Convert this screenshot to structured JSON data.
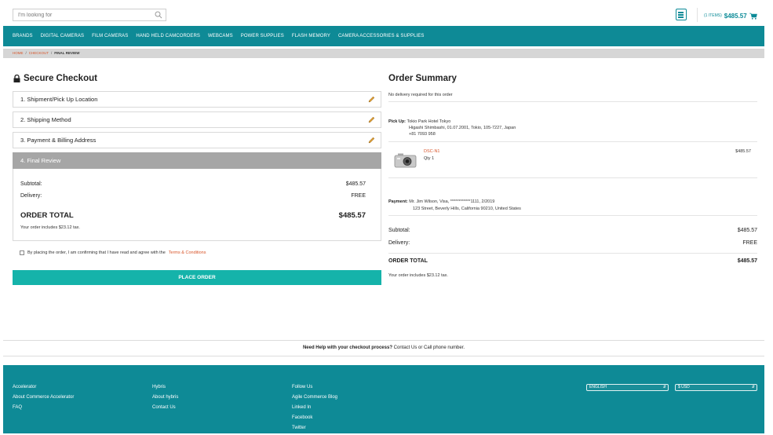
{
  "header": {
    "search_placeholder": "I'm looking for",
    "cart_items": "(1 ITEMS)",
    "cart_total": "$485.57"
  },
  "nav": {
    "items": [
      "BRANDS",
      "DIGITAL CAMERAS",
      "FILM CAMERAS",
      "HAND HELD CAMCORDERS",
      "WEBCAMS",
      "POWER SUPPLIES",
      "FLASH MEMORY",
      "CAMERA ACCESSORIES & SUPPLIES"
    ]
  },
  "breadcrumb": {
    "home": "HOME",
    "checkout": "CHECKOUT",
    "current": "FINAL REVIEW",
    "separator": "/"
  },
  "checkout": {
    "title": "Secure Checkout",
    "steps": [
      "1. Shipment/Pick Up Location",
      "2. Shipping Method",
      "3. Payment & Billing Address",
      "4. Final Review"
    ],
    "subtotal_label": "Subtotal:",
    "subtotal_value": "$485.57",
    "delivery_label": "Delivery:",
    "delivery_value": "FREE",
    "order_total_label": "ORDER TOTAL",
    "order_total_value": "$485.57",
    "tax_note": "Your order includes $23.12 tax.",
    "agree_text": "By placing the order, I am confirming that I have read and agree with the",
    "terms_link": "Terms & Conditions",
    "place_order": "PLACE ORDER"
  },
  "summary": {
    "title": "Order Summary",
    "no_delivery": "No delivery required for this order",
    "pickup_label": "Pick Up:",
    "pickup_name": "Tokio Park Hotel Tokyo",
    "pickup_address": "Higashi Shimbashi, 01.07.2001, Tokio, 105-7227, Japan",
    "pickup_phone": "+81 7093 958",
    "product_name": "DSC-N1",
    "product_qty": "Qty 1",
    "product_price": "$485.57",
    "payment_label": "Payment:",
    "payment_info": "Mr. Jim Wilson, Visa, ************1111, 2/2019",
    "billing_address": "123 Street, Beverly Hills, California 90210, United States",
    "subtotal_label": "Subtotal:",
    "subtotal_value": "$485.57",
    "delivery_label": "Delivery:",
    "delivery_value": "FREE",
    "order_total_label": "ORDER TOTAL",
    "order_total_value": "$485.57",
    "tax_note": "Your order includes $23.12 tax."
  },
  "help": {
    "bold": "Need Help with your checkout process?",
    "rest": " Contact Us or Call phone number."
  },
  "footer": {
    "col1": [
      "Accelerator",
      "About Commerce Accelerator",
      "FAQ"
    ],
    "col2": [
      "Hybris",
      "About hybris",
      "Contact Us"
    ],
    "col3": [
      "Follow Us",
      "Agile Commerce Blog",
      "Linked In",
      "Facebook",
      "Twitter"
    ],
    "language": "ENGLISH",
    "currency": "$ USD"
  },
  "colors": {
    "brand_teal": "#0e8a96",
    "button_teal": "#15b3aa",
    "link_orange": "#d8552a"
  }
}
